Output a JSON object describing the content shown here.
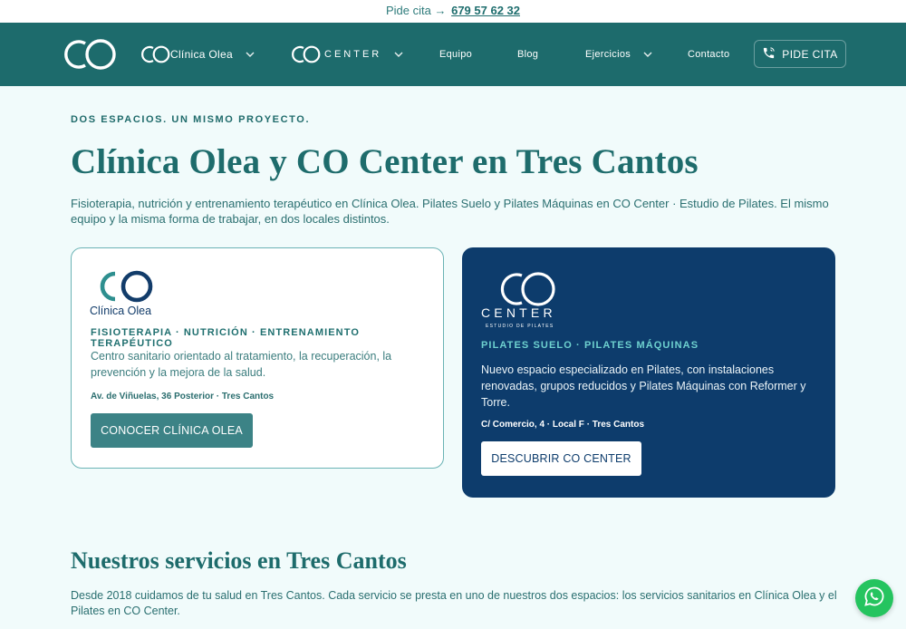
{
  "topbar": {
    "text": "Pide cita →",
    "phone": "679 57 62 32"
  },
  "nav": {
    "logo": "CO",
    "clinica_brand": "Clínica Olea",
    "center_brand": "CENTER",
    "equipo": "Equipo",
    "blog": "Blog",
    "ejercicios": "Ejercicios",
    "contacto": "Contacto",
    "cta": "PIDE CITA"
  },
  "hero": {
    "eyebrow": "DOS ESPACIOS. UN MISMO PROYECTO.",
    "title": "Clínica Olea y CO Center en Tres Cantos",
    "intro": "Fisioterapia, nutrición y entrenamiento terapéutico en Clínica Olea. Pilates Suelo y Pilates Máquinas en CO Center · Estudio de Pilates. El mismo equipo y la misma forma de trabajar, en dos locales distintos."
  },
  "cards": {
    "clinica": {
      "logo_caption": "Clínica Olea",
      "subtitle": "FISIOTERAPIA · NUTRICIÓN · ENTRENAMIENTO TERAPÉUTICO",
      "description": "Centro sanitario orientado al tratamiento, la recuperación, la prevención y la mejora de la salud.",
      "address": "Av. de Viñuelas, 36 Posterior · Tres Cantos",
      "button": "CONOCER CLÍNICA OLEA"
    },
    "center": {
      "logo_word": "CENTER",
      "logo_tagline": "ESTUDIO DE PILATES",
      "subtitle": "PILATES SUELO · PILATES MÁQUINAS",
      "description": "Nuevo espacio especializado en Pilates, con instalaciones renovadas, grupos reducidos y Pilates Máquinas con Reformer y Torre.",
      "address": "C/ Comercio, 4 · Local F · Tres Cantos",
      "button": "DESCUBRIR CO CENTER"
    }
  },
  "services": {
    "title": "Nuestros servicios en Tres Cantos",
    "text": "Desde 2018 cuidamos de tu salud en Tres Cantos. Cada servicio se presta en uno de nuestros dos espacios: los servicios sanitarios en Clínica Olea y el Pilates en CO Center."
  },
  "colors": {
    "nav": "#1d6b6c",
    "accent": "#1e6c6c",
    "dark_card": "#0d3c6c",
    "whatsapp": "#25c45f"
  },
  "icons": [
    "phone-icon",
    "chevron-down-icon",
    "whatsapp-icon"
  ]
}
